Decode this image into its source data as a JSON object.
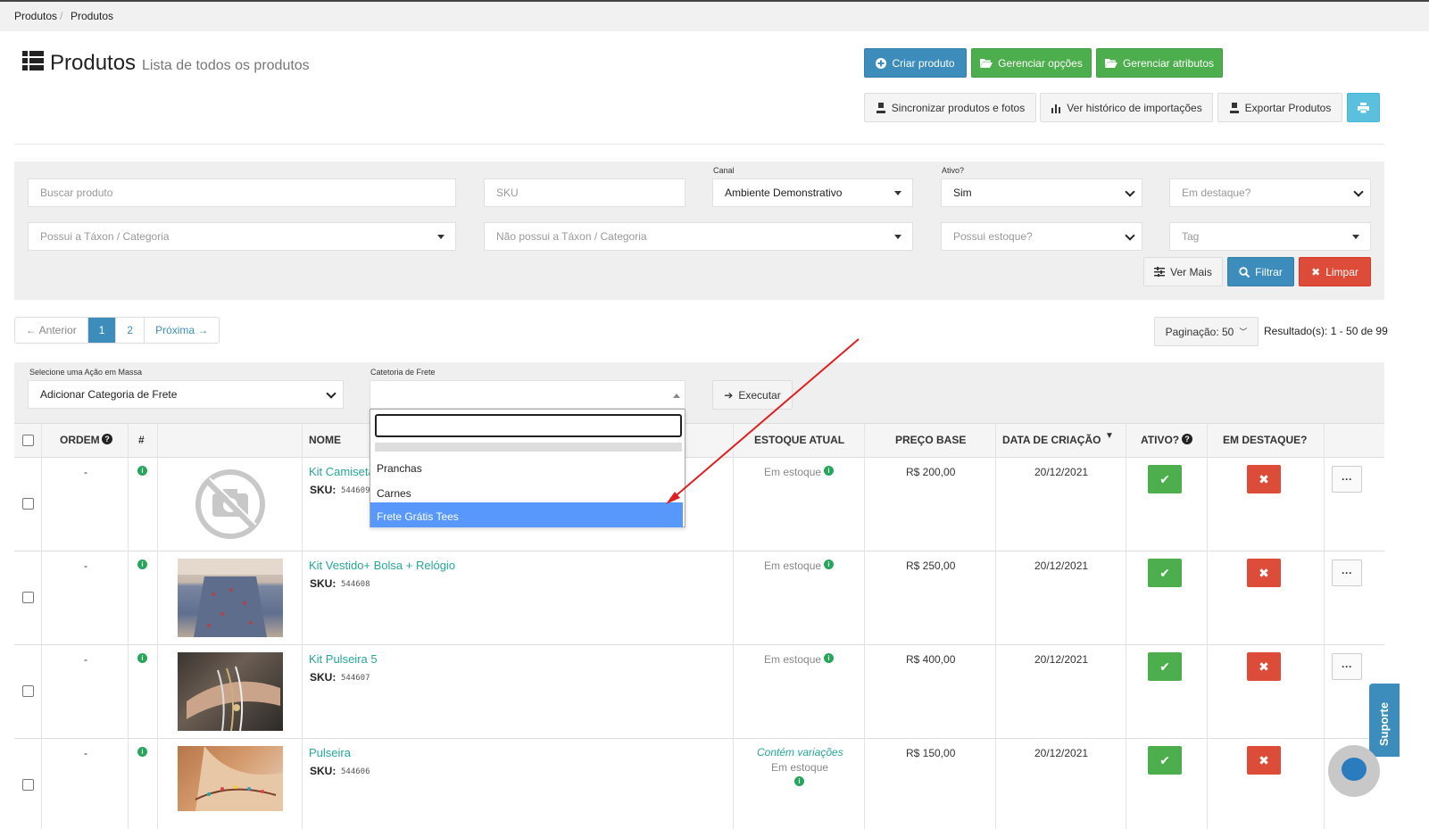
{
  "breadcrumb": {
    "item1": "Produtos",
    "sep": "/",
    "item2": "Produtos"
  },
  "page": {
    "title": "Produtos",
    "subtitle": "Lista de todos os produtos"
  },
  "toolbar": {
    "criar": "Criar produto",
    "opcoes": "Gerenciar opções",
    "atributos": "Gerenciar atributos",
    "sincronizar": "Sincronizar produtos e fotos",
    "historico": "Ver histórico de importações",
    "exportar": "Exportar Produtos"
  },
  "filters": {
    "buscar_placeholder": "Buscar produto",
    "sku_placeholder": "SKU",
    "canal_label": "Canal",
    "canal_value": "Ambiente Demonstrativo",
    "ativo_label": "Ativo?",
    "ativo_value": "Sim",
    "destaque_placeholder": "Em destaque?",
    "possui_taxon": "Possui a Táxon / Categoria",
    "nao_possui_taxon": "Não possui a Táxon / Categoria",
    "possui_estoque": "Possui estoque?",
    "tag": "Tag",
    "ver_mais": "Ver Mais",
    "filtrar": "Filtrar",
    "limpar": "Limpar"
  },
  "pagination": {
    "prev": "← Anterior",
    "pages": [
      "1",
      "2"
    ],
    "next": "Próxima →",
    "per_page": "Paginação: 50",
    "results": "Resultado(s): 1 - 50 de 99"
  },
  "mass": {
    "action_label": "Selecione uma Ação em Massa",
    "action_value": "Adicionar Categoria de Frete",
    "frete_label": "Catetoria de Frete",
    "executar": "Executar"
  },
  "dropdown": {
    "options": [
      "Pranchas",
      "Carnes",
      "Frete Grátis Tees"
    ],
    "selected_index": 2
  },
  "table": {
    "headers": {
      "ordem": "ORDEM",
      "hash": "#",
      "nome": "NOME",
      "estoque": "ESTOQUE ATUAL",
      "preco": "PREÇO BASE",
      "data": "DATA DE CRIAÇÃO",
      "ativo": "ATIVO?",
      "destaque": "EM DESTAQUE?"
    },
    "sku_label": "SKU:",
    "more": "···",
    "rows": [
      {
        "ordem": "-",
        "name": "Kit Camiseta",
        "sku": "544609",
        "stock": "Em estoque",
        "variation": "",
        "price": "R$ 200,00",
        "date": "20/12/2021"
      },
      {
        "ordem": "-",
        "name": "Kit Vestido+ Bolsa + Relógio",
        "sku": "544608",
        "stock": "Em estoque",
        "variation": "",
        "price": "R$ 250,00",
        "date": "20/12/2021"
      },
      {
        "ordem": "-",
        "name": "Kit Pulseira 5",
        "sku": "544607",
        "stock": "Em estoque",
        "variation": "",
        "price": "R$ 400,00",
        "date": "20/12/2021"
      },
      {
        "ordem": "-",
        "name": "Pulseira",
        "sku": "544606",
        "stock": "Em estoque",
        "variation": "Contém variações",
        "price": "R$ 150,00",
        "date": "20/12/2021"
      }
    ]
  },
  "support": {
    "label": "Suporte"
  },
  "colors": {
    "primary": "#3c8dbc",
    "success": "#4cae4c",
    "danger": "#dd4b39",
    "link": "#26a69a",
    "annotation_arrow": "#e02020"
  }
}
